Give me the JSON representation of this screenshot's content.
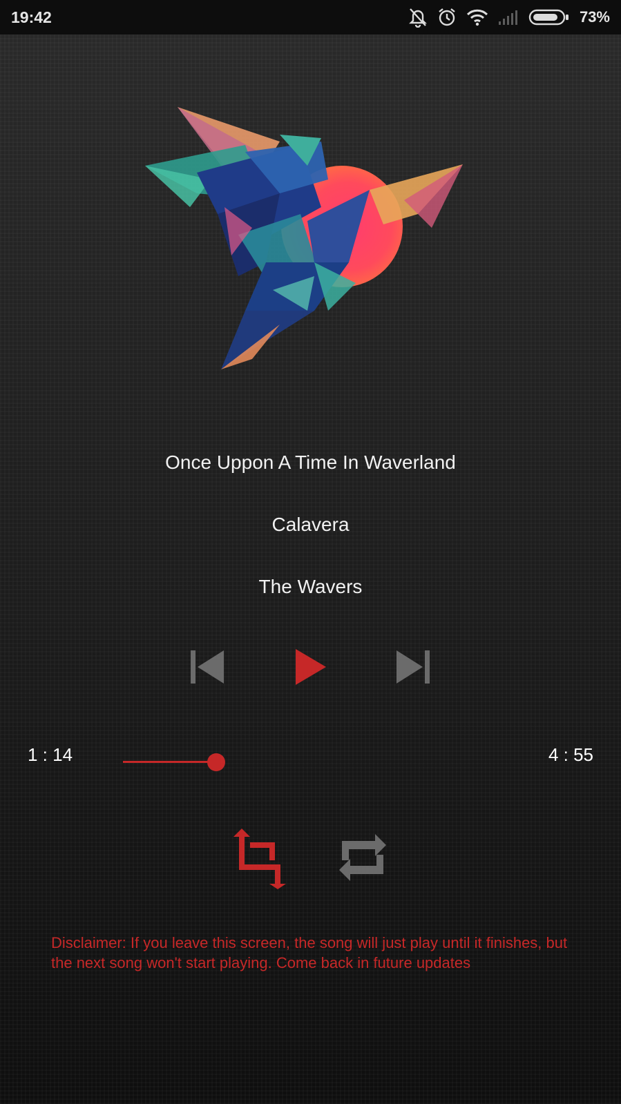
{
  "status_bar": {
    "time": "19:42",
    "battery_percent": "73%",
    "icons": [
      "bell-off-icon",
      "alarm-icon",
      "wifi-icon",
      "signal-icon",
      "battery-icon"
    ]
  },
  "track": {
    "title": "Once Uppon A Time In Waverland",
    "album": "Calavera",
    "artist": "The Wavers"
  },
  "controls": {
    "icons": [
      "skip-previous-icon",
      "play-icon",
      "skip-next-icon"
    ]
  },
  "playback": {
    "current_time": "1 : 14",
    "total_time": "4 : 55",
    "progress_fraction": 0.25
  },
  "modes": {
    "icons": [
      "crop-icon",
      "repeat-icon"
    ]
  },
  "disclaimer": "Disclaimer: If you leave this screen, the song will just play until it finishes, but the next song won't start playing. Come back in future updates",
  "colors": {
    "accent": "#c62828",
    "inactive": "#6b6b6b",
    "background": "#1c1c1c"
  }
}
